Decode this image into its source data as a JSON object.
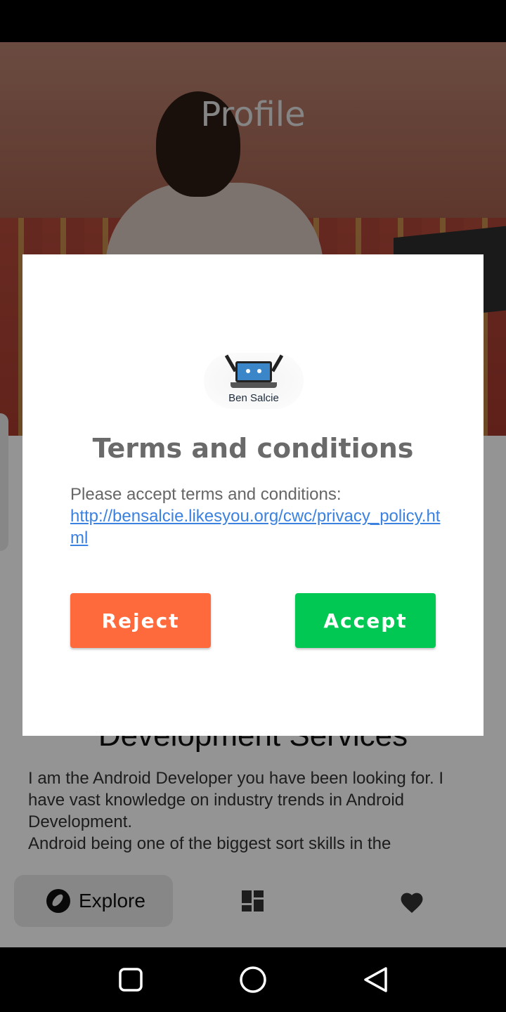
{
  "app": {
    "header_title": "Profile",
    "service_title": "Development Services",
    "service_description": "I am the Android Developer you have been looking for. I have vast knowledge on industry trends in Android Development.\nAndroid being one of the biggest sort skills in the",
    "bottom_nav": {
      "explore_label": "Explore",
      "explore_icon": "compass-icon",
      "dashboard_icon": "dashboard-icon",
      "favorites_icon": "heart-icon"
    }
  },
  "dialog": {
    "logo_text": "Ben Salcie",
    "title": "Terms and conditions",
    "message": "Please accept terms and conditions:",
    "link": "http://bensalcie.likesyou.org/cwc/privacy_policy.html",
    "reject_label": "Reject",
    "accept_label": "Accept"
  },
  "colors": {
    "reject": "#ff6a3d",
    "accept": "#00c853",
    "link": "#3b82e0"
  },
  "system_nav": {
    "recents_icon": "recents-icon",
    "home_icon": "home-icon",
    "back_icon": "back-icon"
  }
}
